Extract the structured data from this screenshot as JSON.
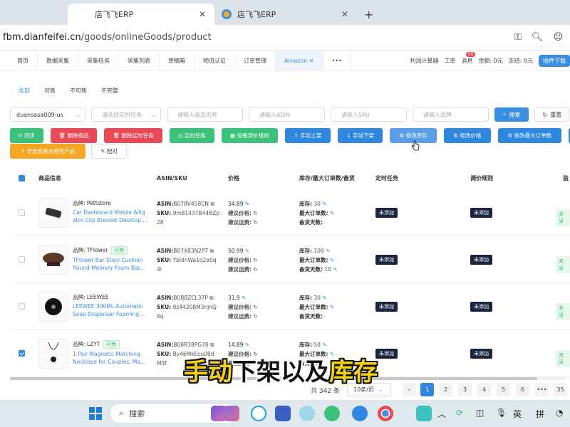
{
  "browser": {
    "tabs": [
      {
        "title": "店飞飞ERP",
        "close": "✕",
        "active": true
      },
      {
        "title": "店飞飞ERP",
        "close": "✕",
        "active": false
      }
    ],
    "new_tab": "+",
    "url_domain": "fbm.dianfeifei.cn",
    "url_path": "/goods/onlineGoods/product",
    "icons": [
      "key-icon",
      "zoom-icon",
      "profile-icon"
    ]
  },
  "nav": {
    "tabs": [
      "首页",
      "数据采集",
      "采集任务",
      "采集列表",
      "草稿箱",
      "物流认证",
      "订单管理",
      "Amazon ✕",
      "•••"
    ],
    "active_index": 7,
    "right": {
      "calc": "利润计算器",
      "ticket": "工单",
      "msg": "消息",
      "msg_count": "56",
      "balance": "余额: 0元",
      "frozen": "冻结: 0元",
      "plugin": "插件下载"
    }
  },
  "filter_tabs": [
    "全部",
    "可售",
    "不可售",
    "不完整"
  ],
  "filters": {
    "store": "duansasa009-us",
    "task_placeholder": "请选择定时任务",
    "name_placeholder": "请输入商品名称",
    "asin_placeholder": "请输入ASIN",
    "sku_placeholder": "请输入SKU",
    "brand_placeholder": "请输入品牌",
    "search": "搜索",
    "reset": "重置"
  },
  "actions": {
    "sync": "同步",
    "delete": "删除商品",
    "delete_task": "删除定时任务",
    "timer": "定时任务",
    "price_rule": "设置调价规则",
    "manual_on": "手动上架",
    "manual_off": "手动下架",
    "edit_stock": "修改库存",
    "edit_price": "修改价格",
    "edit_max": "修改最大订单数",
    "export": "导出监管合规性产品",
    "match": "配对"
  },
  "table": {
    "headers": [
      "商品信息",
      "ASIN/SKU",
      "价格",
      "库存/最大订单数/备货",
      "定时任务",
      "调价规则",
      "监"
    ],
    "rows": [
      {
        "brand_label": "品牌:",
        "brand": "Pettstore",
        "tag": "",
        "title1": "Car Dashboard Mobile Allig",
        "title2": "ator Clip Bracket Desktop ...",
        "asin": "B078V458CN",
        "sku": "9m81437B44BZp",
        "sku2": "28",
        "price": "34.89",
        "suggest": "建议价格:",
        "suggest_ship": "建议运费:",
        "stock": "30",
        "max": "",
        "prep": "",
        "task": "未添加",
        "rule": "未添加",
        "sync": "未采",
        "checked": false
      },
      {
        "brand_label": "品牌:",
        "brand": "TFlower",
        "tag": "可售",
        "title1": "TFlower Bar Stool Cushion",
        "title2": "Round Memory Foam Bar...",
        "asin": "B07X83N2P7",
        "sku": "YbldnWa1q2e0q",
        "sku2": "4I",
        "price": "50.99",
        "suggest": "建议价格:",
        "suggest_ship": "建议运费:",
        "stock": "100",
        "max": "",
        "prep": "10",
        "task": "未添加",
        "rule": "未添加",
        "sync": "未采",
        "checked": false
      },
      {
        "brand_label": "品牌:",
        "brand": "LEEWEE",
        "tag": "",
        "title1": "LEEWEE 300ML Automatic",
        "title2": "Soap Dispenser Foaming ...",
        "asin": "B0B8ZCL37P",
        "sku": "0z44208M3njnQ",
        "sku2": "6q",
        "price": "31.9",
        "suggest": "建议价格:",
        "suggest_ship": "建议运费:",
        "stock": "30",
        "max": "",
        "prep": "",
        "task": "未添加",
        "rule": "未添加",
        "sync": "未采",
        "checked": false
      },
      {
        "brand_label": "品牌:",
        "brand": "LZYT",
        "tag": "可售",
        "title1": "1 Pair Magnetic Matching",
        "title2": "Necklace for Couples, Ma...",
        "asin": "B08R38PG78",
        "sku": "By46MkEcu08d",
        "sku2": "M3f",
        "price": "14.89",
        "suggest": "建议价格:",
        "suggest_ship": "建议运费:",
        "stock": "50",
        "max": "",
        "prep": "",
        "task": "未添加",
        "rule": "未添加",
        "sync": "未采",
        "checked": true
      }
    ],
    "labels": {
      "asin": "ASIN:",
      "sku": "SKU:",
      "stock": "库存:",
      "max": "最大订单数:",
      "prep": "备货天数:"
    }
  },
  "pagination": {
    "total": "共 342 条",
    "per_page": "10条/页",
    "pages": [
      "1",
      "2",
      "3",
      "4",
      "5",
      "6",
      "•••",
      "35"
    ],
    "prev": "‹",
    "active": "1"
  },
  "subtitle": {
    "part1": "手动",
    "part2": "下架以及",
    "part3": "库存"
  },
  "taskbar": {
    "search": "搜索",
    "lang": "英",
    "ime": "拼"
  }
}
